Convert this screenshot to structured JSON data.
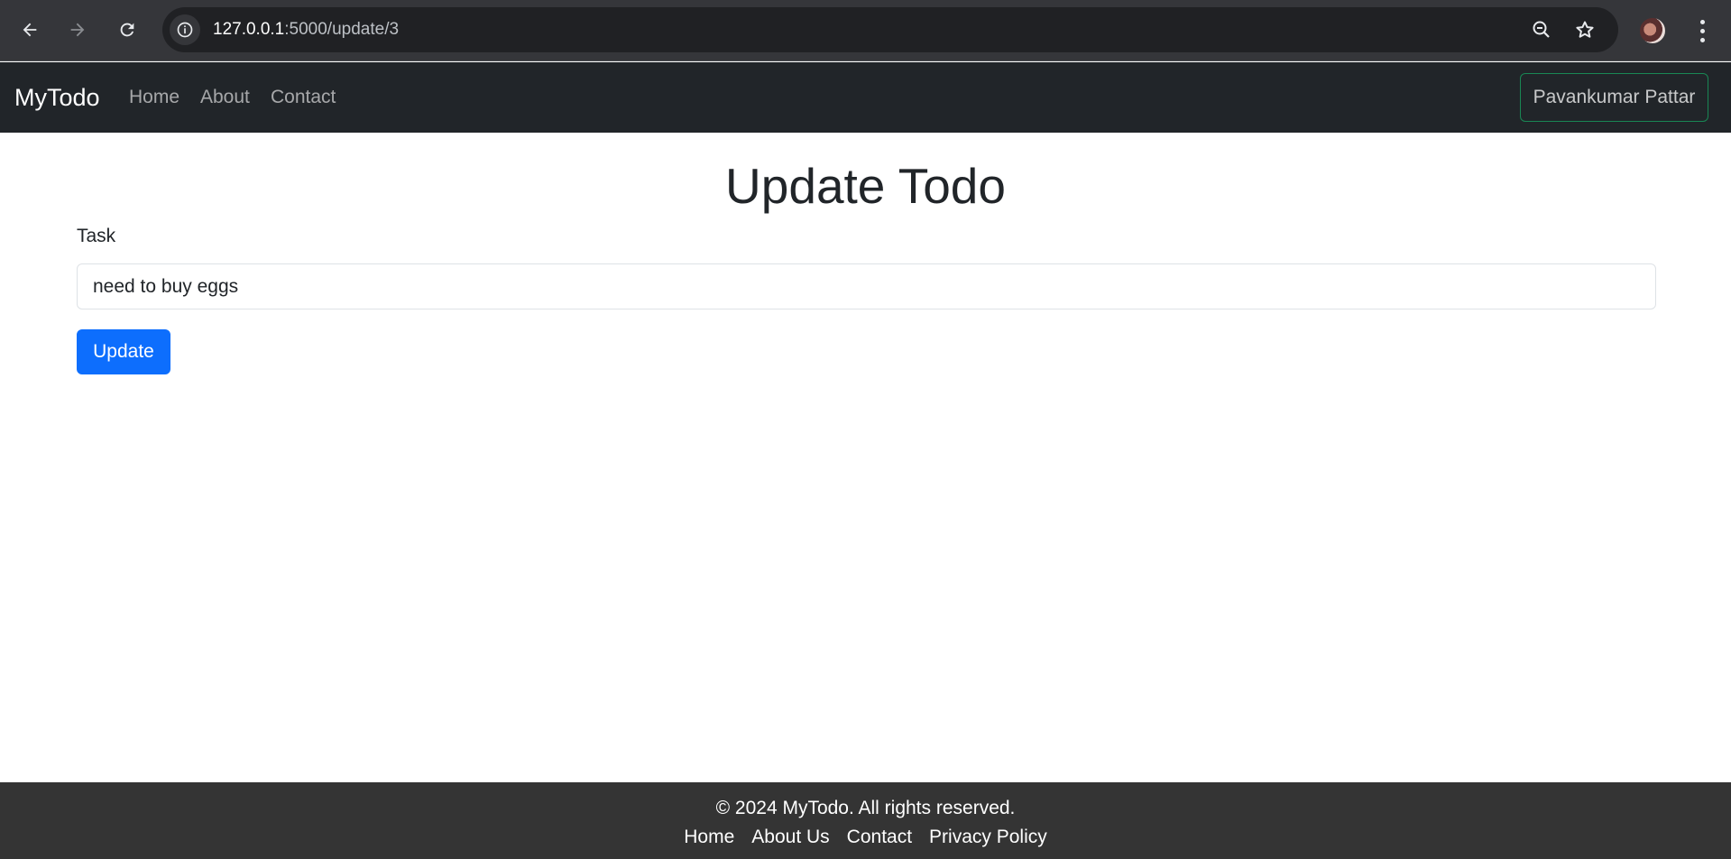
{
  "browser": {
    "url_host": "127.0.0.1",
    "url_path": ":5000/update/3",
    "icons": [
      "back-arrow-icon",
      "forward-arrow-icon",
      "reload-icon",
      "site-info-icon",
      "zoom-out-icon",
      "bookmark-star-icon",
      "kebab-menu-icon"
    ]
  },
  "navbar": {
    "brand": "MyTodo",
    "links": [
      "Home",
      "About",
      "Contact"
    ],
    "user": "Pavankumar Pattar"
  },
  "main": {
    "title": "Update Todo",
    "task_label": "Task",
    "task_value": "need to buy eggs",
    "update_label": "Update"
  },
  "footer": {
    "copyright": "© 2024 MyTodo. All rights reserved.",
    "links": [
      "Home",
      "About Us",
      "Contact",
      "Privacy Policy"
    ]
  },
  "colors": {
    "navbar_bg": "#212529",
    "primary": "#0d6efd",
    "success_border": "#198754",
    "footer_bg": "#343434"
  }
}
